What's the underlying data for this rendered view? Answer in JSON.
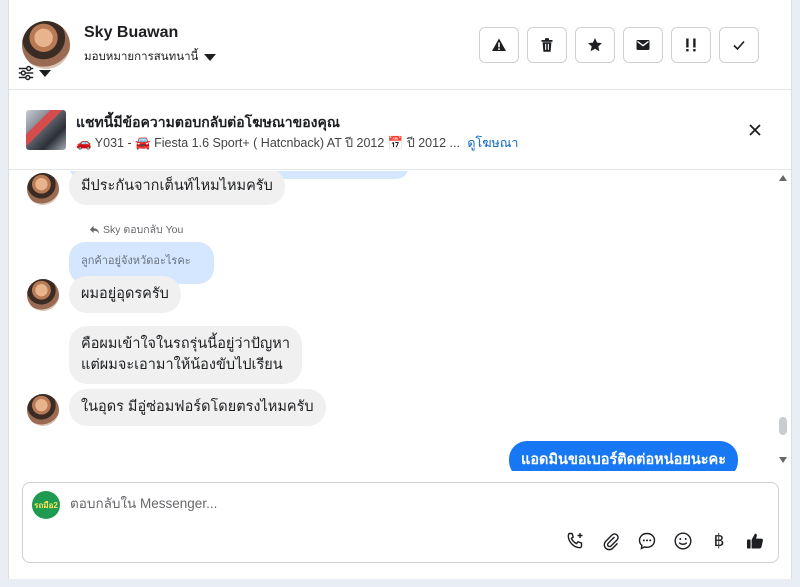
{
  "header": {
    "name": "Sky Buawan",
    "assign_label": "มอบหมายการสนทนานี้",
    "actions": [
      "warning-icon",
      "trash-icon",
      "star-icon",
      "mail-icon",
      "priority-icon",
      "check-icon"
    ]
  },
  "banner": {
    "title": "แชทนี้มีข้อความตอบกลับต่อโฆษณาของคุณ",
    "subtitle": "🚗 Y031 - 🚘 Fiesta 1.6 Sport+ ( Hatcnback) AT ปี 2012 📅 ปี 2012 ...",
    "link": "ดูโฆษณา"
  },
  "messages": {
    "m1": "มีประกันจากเต็นท์ไหมไหมครับ",
    "reply_note": "Sky ตอบกลับ You",
    "quote": "ลูกค้าอยู่จังหวัดอะไรคะ",
    "m2": "ผมอยู่อุดรครับ",
    "m3_line1": "คือผมเข้าใจในรถรุ่นนี้อยู่ว่าปัญหา",
    "m3_line2": "แต่ผมจะเอามาให้น้องขับไปเรียน",
    "m4": "ในอุดร มีอู่ซ่อมฟอร์ดโดยตรงไหมครับ",
    "out1": "แอดมินขอเบอร์ติดต่อหน่อยนะคะ"
  },
  "composer": {
    "placeholder": "ตอบกลับใน Messenger...",
    "logo_text": "รถมือ2",
    "currency": "฿"
  },
  "colors": {
    "accent": "#1877f2",
    "quote_bg": "#d5e6ff",
    "incoming_bg": "#f0f0f0"
  }
}
